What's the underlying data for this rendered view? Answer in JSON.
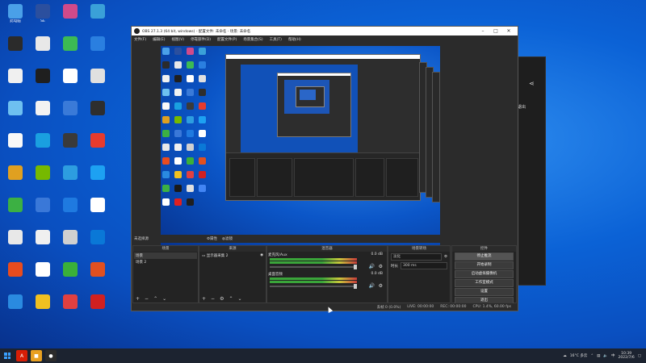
{
  "desktop": {
    "icons": [
      {
        "label": "此电脑",
        "color": "#4aa0e8"
      },
      {
        "label": "SE",
        "color": "#2b4f9e"
      },
      {
        "label": "",
        "color": "#d04a8a"
      },
      {
        "label": "",
        "color": "#3aa0d8"
      },
      {
        "label": "",
        "color": "#2b2b2b"
      },
      {
        "label": "",
        "color": "#e8e8e8"
      },
      {
        "label": "",
        "color": "#3cba54"
      },
      {
        "label": "",
        "color": "#2a7fe0"
      },
      {
        "label": "",
        "color": "#f0f0f0"
      },
      {
        "label": "",
        "color": "#1f1f1f"
      },
      {
        "label": "",
        "color": "#ffffff"
      },
      {
        "label": "",
        "color": "#e0e0e0"
      },
      {
        "label": "",
        "color": "#6ec0f0"
      },
      {
        "label": "",
        "color": "#f2f2f2"
      },
      {
        "label": "",
        "color": "#3a7ad8"
      },
      {
        "label": "",
        "color": "#2e2e2e"
      },
      {
        "label": "",
        "color": "#f8f8f8"
      },
      {
        "label": "",
        "color": "#1aa0e0"
      },
      {
        "label": "",
        "color": "#3a3a3a"
      },
      {
        "label": "",
        "color": "#e63b2e"
      },
      {
        "label": "",
        "color": "#e0a020"
      },
      {
        "label": "",
        "color": "#76b900"
      },
      {
        "label": "",
        "color": "#2d9de0"
      },
      {
        "label": "",
        "color": "#1da1f2"
      },
      {
        "label": "",
        "color": "#3cb043"
      },
      {
        "label": "",
        "color": "#3a78d8"
      },
      {
        "label": "",
        "color": "#1f7ae0"
      },
      {
        "label": "",
        "color": "#ffffff"
      },
      {
        "label": "",
        "color": "#e8e8e8"
      },
      {
        "label": "",
        "color": "#f0f0f0"
      },
      {
        "label": "",
        "color": "#d0d0d0"
      },
      {
        "label": "",
        "color": "#0a78d7"
      },
      {
        "label": "",
        "color": "#e84c1e"
      },
      {
        "label": "",
        "color": "#ffffff"
      },
      {
        "label": "",
        "color": "#3ab03a"
      },
      {
        "label": "",
        "color": "#e05020"
      },
      {
        "label": "",
        "color": "#2a8ae0"
      },
      {
        "label": "",
        "color": "#f0c020"
      },
      {
        "label": "",
        "color": "#e04040"
      },
      {
        "label": "",
        "color": "#d02020"
      },
      {
        "label": "",
        "color": "#3cb043"
      },
      {
        "label": "",
        "color": "#1a1a1a"
      },
      {
        "label": "",
        "color": "#e0e0e0"
      },
      {
        "label": "",
        "color": "#4285f4"
      },
      {
        "label": "",
        "color": "#ffffff"
      },
      {
        "label": "",
        "color": "#e02020"
      },
      {
        "label": "",
        "color": "#1f1f1f"
      }
    ]
  },
  "obs": {
    "title": "OBS 27.1.3 (64 bit, windows) - 配置文件: 未命名 - 场景: 未命名",
    "menu": [
      "文件(F)",
      "编辑(E)",
      "视图(V)",
      "停靠部件(D)",
      "配置文件(P)",
      "场景集合(S)",
      "工具(T)",
      "帮助(H)"
    ],
    "scene_bar": {
      "source_label": "未选择源",
      "props": "属性",
      "filters": "滤镜"
    },
    "docks": {
      "scenes": {
        "title": "场景",
        "items": [
          "场景",
          "场景 2"
        ]
      },
      "sources": {
        "title": "来源",
        "items": [
          "显示器采集 2"
        ]
      },
      "mixer": {
        "title": "混音器",
        "rows": [
          {
            "name": "麦克风/Aux",
            "db": "0.0 dB"
          },
          {
            "name": "桌面音频",
            "db": "0.0 dB"
          }
        ]
      },
      "transitions": {
        "title": "场景转场",
        "type": "淡化",
        "duration_label": "时长",
        "duration": "300 ms"
      },
      "controls": {
        "title": "控件",
        "buttons": [
          "停止推流",
          "开始录制",
          "启动虚拟摄像机",
          "工作室模式",
          "设置",
          "退出"
        ]
      }
    },
    "status": {
      "dropped": "丢帧 0 (0.0%)",
      "live": "LIVE: 00:00:00",
      "rec": "REC: 00:00:00",
      "cpu": "CPU: 1.4%, 60.00 fps"
    }
  },
  "bg_window": {
    "close_label": "退出"
  },
  "taskbar": {
    "apps": [
      {
        "name": "acrobat",
        "color": "#d81e06",
        "glyph": "A"
      },
      {
        "name": "folder",
        "color": "#e8a020",
        "glyph": "■"
      },
      {
        "name": "obs",
        "color": "#2b2b2b",
        "glyph": "●"
      }
    ],
    "weather": "16°C 多云",
    "time": "10:39",
    "date": "2022/7/6"
  }
}
